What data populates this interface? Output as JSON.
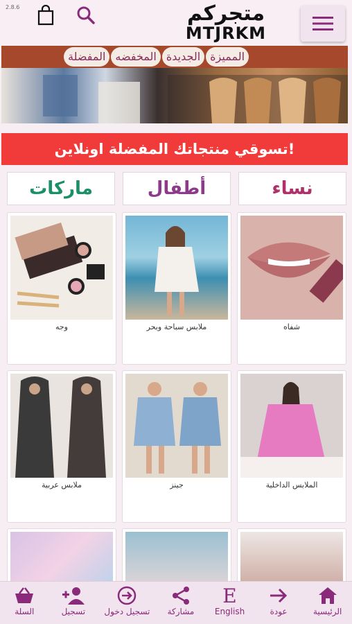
{
  "header": {
    "version": "2.8.6",
    "logo_arabic": "متجركم",
    "logo_latin": "MTJRKM"
  },
  "category_pills": [
    "المفضلة",
    "المخفضه",
    "الجديدة",
    "المميزة"
  ],
  "promo_text": "تسوقي منتجاتك المفضلة اونلاين!",
  "tabs": {
    "women": "نساء",
    "kids": "أطفال",
    "brands": "ماركات"
  },
  "products": [
    {
      "label": "وجه"
    },
    {
      "label": "ملابس سباحة وبحر"
    },
    {
      "label": "شفاه"
    },
    {
      "label": "ملابس عربية"
    },
    {
      "label": "جينز"
    },
    {
      "label": "الملابس الداخلية"
    },
    {
      "label": ""
    },
    {
      "label": ""
    },
    {
      "label": ""
    }
  ],
  "bottom_nav": {
    "cart": "السلة",
    "register": "تسجيل",
    "login": "تسجيل دخول",
    "share": "مشاركة",
    "language": "English",
    "back": "عودة",
    "home": "الرئيسية"
  },
  "colors": {
    "accent": "#8a2a7a",
    "promo": "#f13b3b",
    "category_bar": "#a5482c"
  }
}
